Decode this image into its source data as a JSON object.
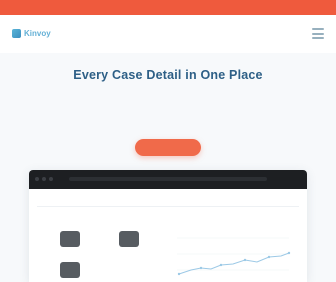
{
  "banner": {
    "text": ""
  },
  "nav": {
    "logo_text": "Kinvoy"
  },
  "hero": {
    "title": "Every Case Detail in One Place",
    "subtitle": "",
    "cta_label": ""
  },
  "app": {
    "heading": "",
    "tiles": [
      {
        "label": ""
      },
      {
        "label": ""
      },
      {
        "label": ""
      }
    ],
    "chart_title": ""
  },
  "colors": {
    "banner": "#ef5a3d",
    "title": "#2d5f86",
    "cta": "#f06a4a",
    "app_header": "#1d1f22",
    "chart_line": "#9cc9e6"
  }
}
